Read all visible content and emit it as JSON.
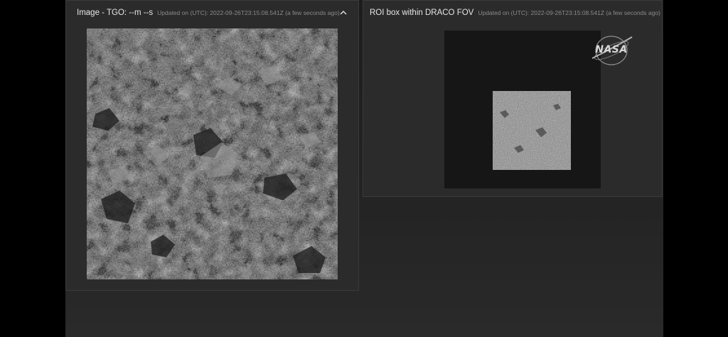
{
  "panels": {
    "left": {
      "title": "Image - TGO: --m --s",
      "updated": "Updated on (UTC): 2022-09-26T23:15:08.541Z (a few seconds ago)",
      "collapse_icon": "chevron-up-icon"
    },
    "right": {
      "title": "ROI box within DRACO FOV",
      "updated": "Updated on (UTC): 2022-09-26T23:15:08.541Z (a few seconds ago)"
    }
  },
  "logo": {
    "text": "NASA",
    "icon": "nasa-meatball-logo"
  },
  "colors": {
    "panel_bg": "#2b2b2b",
    "screen_bg": "#1f1f1f",
    "fov_bg": "#161616",
    "title_text": "#e6e6e6",
    "muted_text": "#8a8a8a"
  }
}
